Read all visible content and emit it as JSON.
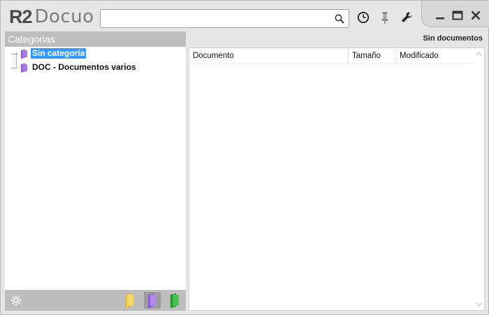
{
  "app": {
    "logo_mark": "R2",
    "logo_name": "Docuo"
  },
  "search": {
    "value": "",
    "placeholder": ""
  },
  "toolbar": {
    "icons": [
      "history-clock-icon",
      "pin-icon",
      "wrench-settings-icon"
    ],
    "window_controls": [
      "minimize-icon",
      "maximize-icon",
      "close-icon"
    ]
  },
  "sidebar": {
    "title": "Categorias",
    "tree": [
      {
        "label": "Sin categoría",
        "icon": "purple-folder-icon",
        "selected": true
      },
      {
        "label": "DOC - Documentos varios",
        "icon": "purple-folder-icon",
        "selected": false
      }
    ],
    "footer_icons": [
      "gear-icon",
      "yellow-folder-icon",
      "purple-folder-icon",
      "green-folder-icon"
    ]
  },
  "main": {
    "status": "Sin documentos",
    "columns": [
      "Documento",
      "Tamaño",
      "Modificado"
    ],
    "rows": []
  },
  "colors": {
    "selection": "#3399ff",
    "panel_header": "#bdbdbd",
    "folder_purple": "#a77be0",
    "folder_yellow": "#f2d25c",
    "folder_green": "#3cb043"
  }
}
